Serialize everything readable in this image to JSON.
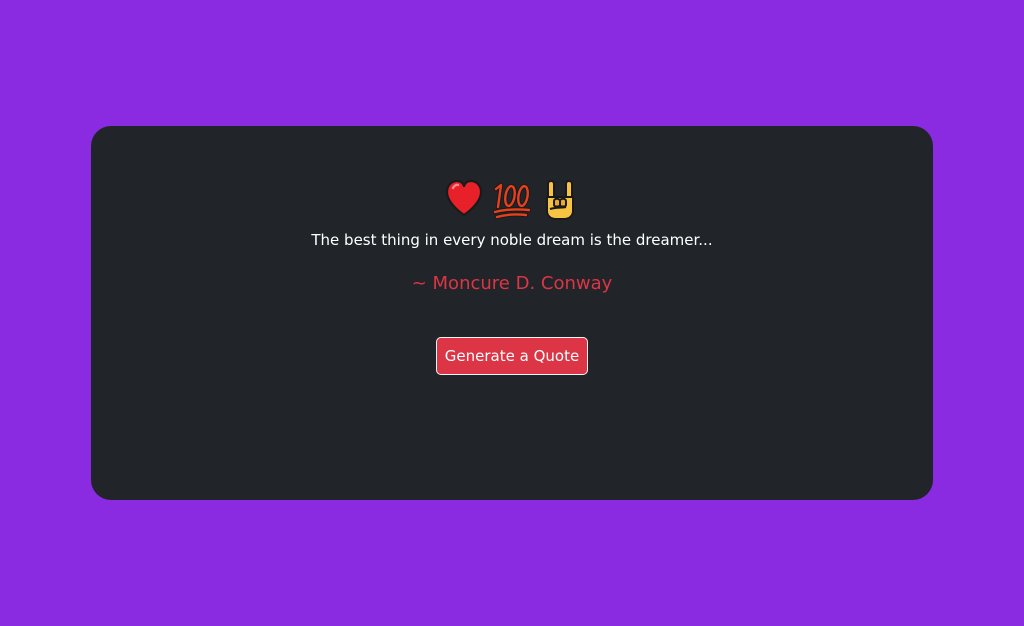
{
  "emojis": [
    "heart-emoji",
    "hundred-points-emoji",
    "sign-of-the-horns-emoji"
  ],
  "quote": {
    "text": "The best thing in every noble dream is the dreamer...",
    "author": "~ Moncure D. Conway"
  },
  "button": {
    "label": "Generate a Quote"
  },
  "colors": {
    "background": "#8a2be2",
    "card": "#212529",
    "accent": "#dc3545",
    "text": "#ffffff"
  }
}
